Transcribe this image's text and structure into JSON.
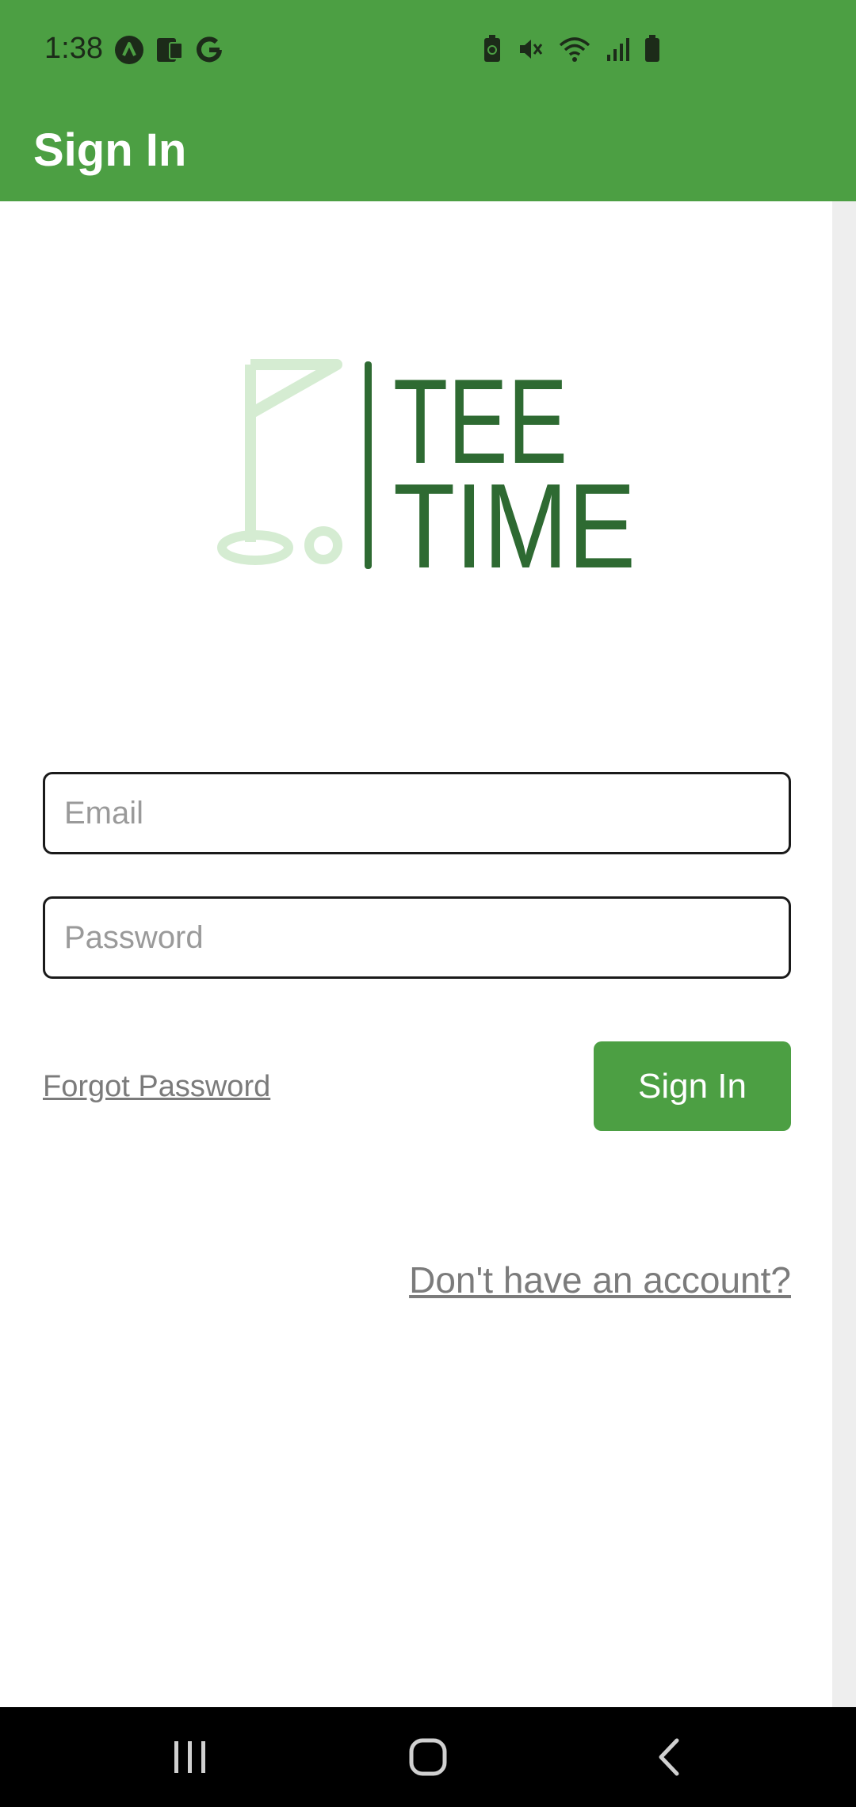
{
  "status_bar": {
    "time": "1:38",
    "left_icons": [
      "app-notification-icon",
      "cast-icon",
      "google-icon"
    ],
    "right_icons": [
      "battery-saver-icon",
      "mute-icon",
      "wifi-icon",
      "signal-icon",
      "battery-icon"
    ]
  },
  "app_bar": {
    "title": "Sign In"
  },
  "logo": {
    "line1": "TEE",
    "line2": "TIME",
    "colors": {
      "flag": "#d5ecd2",
      "text": "#2e6a32"
    }
  },
  "form": {
    "email_placeholder": "Email",
    "password_placeholder": "Password",
    "forgot_label": "Forgot Password ",
    "signin_label": "Sign In",
    "no_account_label": "Don't have an account? "
  },
  "nav_bar": {
    "buttons": [
      "recents-icon",
      "home-icon",
      "back-icon"
    ]
  },
  "colors": {
    "accent": "#4c9f43",
    "link": "#7b7b7b"
  }
}
